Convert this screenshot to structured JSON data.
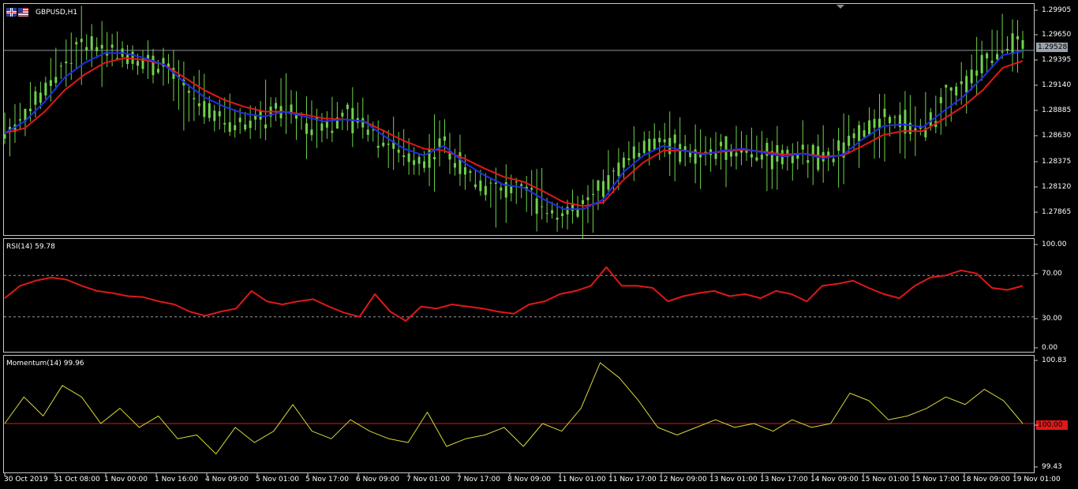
{
  "symbol": {
    "label": "GBPUSD,H1",
    "icons": [
      "uk-flag-icon",
      "us-flag-icon"
    ]
  },
  "price_axis": {
    "labels": [
      "1.29905",
      "1.29650",
      "1.29395",
      "1.29140",
      "1.28885",
      "1.28630",
      "1.28375",
      "1.28120",
      "1.27865"
    ],
    "current_price": "1.29528"
  },
  "rsi": {
    "label": "RSI(14)",
    "value": "59.78",
    "axis_labels": [
      "100.00",
      "70.00",
      "30.00",
      "0.00"
    ],
    "levels": [
      70,
      30
    ]
  },
  "momentum": {
    "label": "Momentum(14)",
    "value": "99.96",
    "axis_labels": [
      "100.83",
      "99.43"
    ],
    "baseline_label": "100.00"
  },
  "time_axis": {
    "labels": [
      "30 Oct 2019",
      "31 Oct 08:00",
      "1 Nov 00:00",
      "1 Nov 16:00",
      "4 Nov 09:00",
      "5 Nov 01:00",
      "5 Nov 17:00",
      "6 Nov 09:00",
      "7 Nov 01:00",
      "7 Nov 17:00",
      "8 Nov 09:00",
      "11 Nov 01:00",
      "11 Nov 17:00",
      "12 Nov 09:00",
      "13 Nov 01:00",
      "13 Nov 17:00",
      "14 Nov 09:00",
      "15 Nov 01:00",
      "15 Nov 17:00",
      "18 Nov 09:00",
      "19 Nov 01:00"
    ]
  },
  "colors": {
    "background": "#000000",
    "candles": "#6fd24a",
    "ma_fast": "#1f2fe0",
    "ma_slow": "#e01818",
    "rsi_line": "#e01818",
    "momentum_line": "#d8d83a",
    "baseline": "#e01818",
    "grid": "#c8c8c8"
  },
  "chart_data": [
    {
      "type": "line",
      "title": "GBPUSD,H1",
      "ylim": [
        1.2765,
        1.2998
      ],
      "series": [
        {
          "values": [
            1.2868,
            1.2885,
            1.291,
            1.294,
            1.296,
            1.2955,
            1.295,
            1.294,
            1.2935,
            1.2912,
            1.2895,
            1.288,
            1.2878,
            1.2885,
            1.2895,
            1.288,
            1.2878,
            1.2883,
            1.288,
            1.286,
            1.2845,
            1.2838,
            1.286,
            1.2828,
            1.2815,
            1.2808,
            1.281,
            1.2792,
            1.2785,
            1.279,
            1.281,
            1.284,
            1.2852,
            1.2862,
            1.2848,
            1.2845,
            1.285,
            1.2852,
            1.2846,
            1.2842,
            1.2848,
            1.284,
            1.285,
            1.287,
            1.2882,
            1.288,
            1.287,
            1.29,
            1.2915,
            1.2938,
            1.296,
            1.2955
          ]
        },
        {
          "values": [
            1.2868,
            1.288,
            1.29,
            1.2925,
            1.294,
            1.295,
            1.295,
            1.2945,
            1.2938,
            1.292,
            1.2905,
            1.2895,
            1.2888,
            1.2885,
            1.289,
            1.2885,
            1.288,
            1.2882,
            1.288,
            1.2865,
            1.2852,
            1.2845,
            1.2855,
            1.2838,
            1.2825,
            1.2815,
            1.2812,
            1.28,
            1.279,
            1.279,
            1.28,
            1.2828,
            1.2845,
            1.2855,
            1.285,
            1.2846,
            1.285,
            1.2852,
            1.2848,
            1.2844,
            1.2847,
            1.2842,
            1.2846,
            1.2862,
            1.2875,
            1.2877,
            1.2874,
            1.289,
            1.2905,
            1.2925,
            1.2948,
            1.2952
          ]
        },
        {
          "values": [
            1.2868,
            1.2873,
            1.289,
            1.2912,
            1.2928,
            1.294,
            1.2945,
            1.2943,
            1.2938,
            1.2925,
            1.2912,
            1.2902,
            1.2895,
            1.289,
            1.289,
            1.2887,
            1.2883,
            1.2882,
            1.288,
            1.287,
            1.286,
            1.2852,
            1.285,
            1.2842,
            1.2832,
            1.2823,
            1.2818,
            1.2808,
            1.2797,
            1.2793,
            1.2797,
            1.282,
            1.2838,
            1.285,
            1.285,
            1.2847,
            1.2849,
            1.2851,
            1.2849,
            1.2846,
            1.2847,
            1.2844,
            1.2845,
            1.2855,
            1.2866,
            1.287,
            1.287,
            1.2882,
            1.2895,
            1.2912,
            1.2935,
            1.2942
          ]
        }
      ]
    },
    {
      "type": "line",
      "title": "RSI(14)",
      "ylim": [
        0,
        100
      ],
      "series": [
        {
          "values": [
            48,
            60,
            65,
            68,
            66,
            60,
            55,
            53,
            50,
            49,
            45,
            42,
            35,
            31,
            35,
            38,
            55,
            45,
            42,
            45,
            47,
            40,
            34,
            30,
            52,
            35,
            26,
            40,
            38,
            42,
            40,
            38,
            35,
            33,
            42,
            45,
            52,
            55,
            60,
            78,
            60,
            60,
            58,
            45,
            50,
            53,
            55,
            50,
            52,
            48,
            55,
            52,
            45,
            60,
            62,
            65,
            58,
            52,
            48,
            60,
            68,
            70,
            75,
            72,
            58,
            56,
            60
          ]
        }
      ]
    },
    {
      "type": "line",
      "title": "Momentum(14)",
      "ylim": [
        99.43,
        100.83
      ],
      "series": [
        {
          "values": [
            100.0,
            100.35,
            100.1,
            100.5,
            100.35,
            100.0,
            100.2,
            99.95,
            100.1,
            99.8,
            99.85,
            99.6,
            99.95,
            99.75,
            99.9,
            100.25,
            99.9,
            99.8,
            100.05,
            99.9,
            99.8,
            99.75,
            100.15,
            99.7,
            99.8,
            99.85,
            99.95,
            99.7,
            100.0,
            99.9,
            100.2,
            100.8,
            100.6,
            100.3,
            99.95,
            99.85,
            99.95,
            100.05,
            99.95,
            100.0,
            99.9,
            100.05,
            99.95,
            100.0,
            100.4,
            100.3,
            100.05,
            100.1,
            100.2,
            100.35,
            100.25,
            100.45,
            100.3,
            100.0
          ]
        }
      ]
    }
  ]
}
